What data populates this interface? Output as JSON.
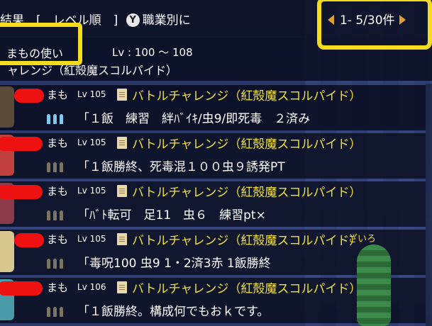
{
  "topbar": {
    "sort_text": "結果　[　レベル順　]",
    "y_button": "Y",
    "job_sort_label": "職業別に",
    "pager_text": "1- 5/30件"
  },
  "filter": {
    "job": "まもの使い",
    "level_range": "Lv : 100 ～ 108",
    "subtitle": "ャレンジ（紅殻魔スコルパイド）"
  },
  "rows": [
    {
      "job": "まも",
      "level": "Lv 105",
      "title": "バトルチャレンジ（紅殻魔スコルパイド）",
      "message": "「１飯　練習　絆ﾊﾞｲｷ/虫9/即死毒　２済み"
    },
    {
      "job": "まも",
      "level": "Lv 105",
      "title": "バトルチャレンジ（紅殻魔スコルパイド）",
      "message": "「１飯勝終、死毒混１００虫９誘発PT"
    },
    {
      "job": "まも",
      "level": "Lv 105",
      "title": "バトルチャレンジ（紅殻魔スコルパイド）",
      "message": "「ﾊﾞﾄ転可　足11　虫６　練習pt×"
    },
    {
      "job": "まも",
      "level": "Lv 105",
      "title": "バトルチャレンジ（紅殻魔スコルパイド）",
      "message": "「毒呪100 虫9 1・2済3赤 1飯勝終"
    },
    {
      "job": "まも",
      "level": "Lv 106",
      "title": "バトルチャレンジ（紅殻魔スコルパイド）",
      "message": "「１飯勝終。構成何でもおｋです。"
    }
  ],
  "npc_label": "ざいろ",
  "colors": {
    "title_yellow": "#f1e236",
    "highlight": "#f5dc1c",
    "redaction": "#ee1111"
  }
}
